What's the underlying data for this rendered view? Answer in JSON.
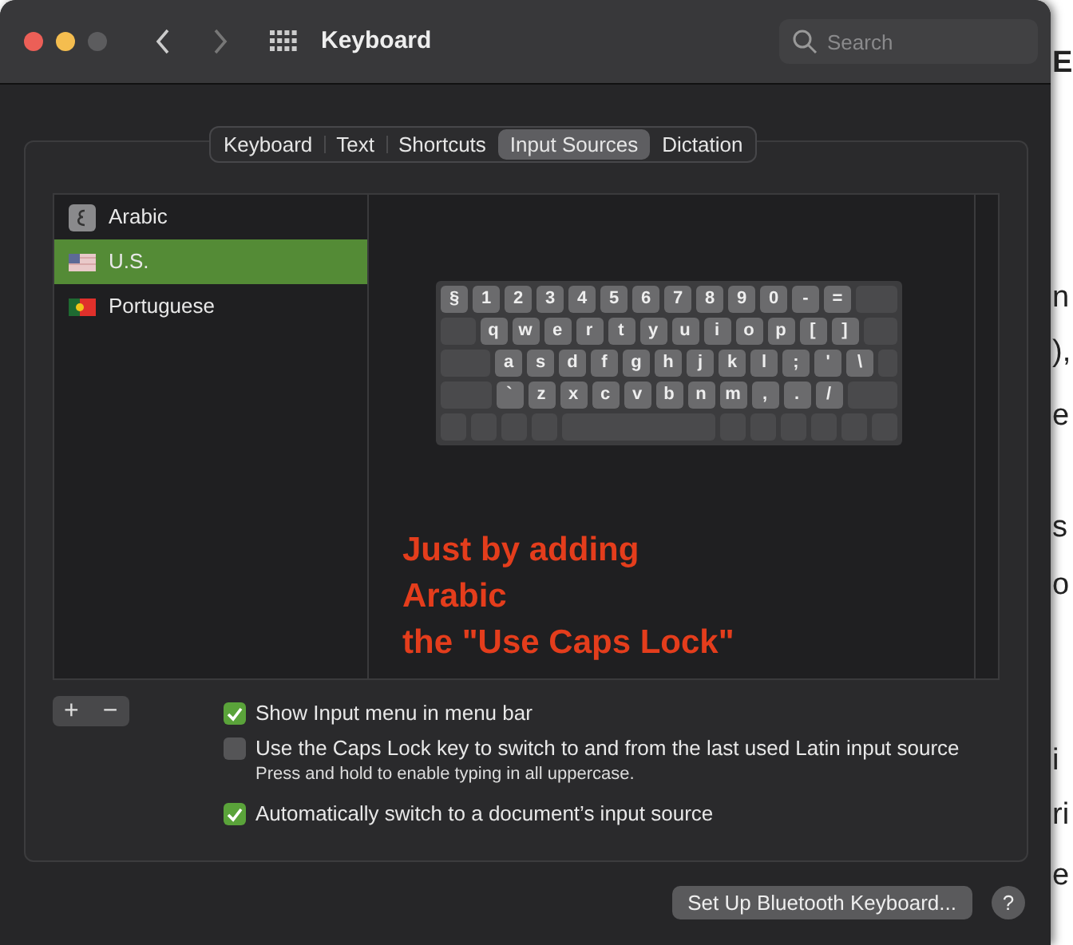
{
  "window": {
    "title": "Keyboard",
    "search": {
      "placeholder": "Search"
    }
  },
  "tabs": [
    {
      "label": "Keyboard",
      "selected": false
    },
    {
      "label": "Text",
      "selected": false
    },
    {
      "label": "Shortcuts",
      "selected": false
    },
    {
      "label": "Input Sources",
      "selected": true
    },
    {
      "label": "Dictation",
      "selected": false
    }
  ],
  "input_sources": [
    {
      "name": "Arabic",
      "kind": "arabic",
      "selected": false
    },
    {
      "name": "U.S.",
      "kind": "us",
      "selected": true
    },
    {
      "name": "Portuguese",
      "kind": "portugal",
      "selected": false
    }
  ],
  "keyboard_rows": [
    [
      "§",
      "1",
      "2",
      "3",
      "4",
      "5",
      "6",
      "7",
      "8",
      "9",
      "0",
      "-",
      "="
    ],
    [
      "q",
      "w",
      "e",
      "r",
      "t",
      "y",
      "u",
      "i",
      "o",
      "p",
      "[",
      "]"
    ],
    [
      "a",
      "s",
      "d",
      "f",
      "g",
      "h",
      "j",
      "k",
      "l",
      ";",
      "'",
      "\\"
    ],
    [
      "`",
      "z",
      "x",
      "c",
      "v",
      "b",
      "n",
      "m",
      ",",
      ".",
      "/"
    ]
  ],
  "annotation": [
    "Just by adding",
    "Arabic",
    "the \"Use Caps Lock\""
  ],
  "list_buttons": [
    "+",
    "−"
  ],
  "options": [
    {
      "label": "Show Input menu in menu bar",
      "checked": true
    },
    {
      "label": "Use the Caps Lock key to switch to and from the last used Latin input source",
      "checked": false,
      "note": "Press and hold to enable typing in all uppercase."
    },
    {
      "label": "Automatically switch to a document’s input source",
      "checked": true
    }
  ],
  "bluetooth_button": "Set Up Bluetooth Keyboard...",
  "help_button": "?",
  "background_page": [
    "E",
    "n",
    "),",
    "e",
    "s",
    "o",
    "i",
    "ri",
    "e"
  ]
}
